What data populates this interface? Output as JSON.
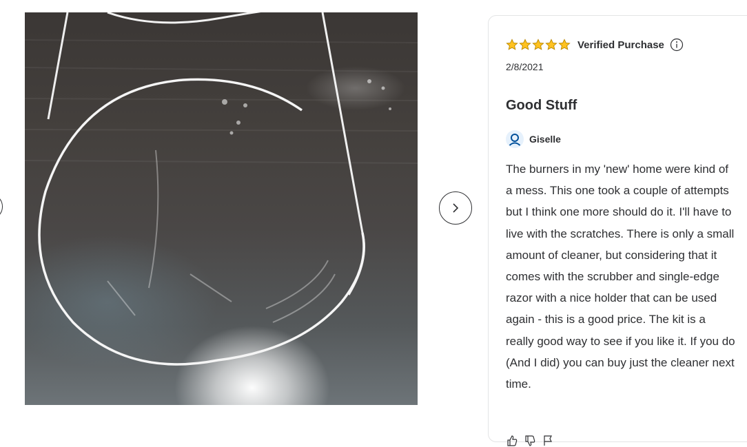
{
  "review": {
    "rating": 5,
    "rating_max": 5,
    "verified_label": "Verified Purchase",
    "date": "2/8/2021",
    "title": "Good Stuff",
    "author": "Giselle",
    "body": "The burners in my 'new' home were kind of a mess. This one took a couple of attempts but I think one more should do it. I'll have to live with the scratches. There is only a small amount of cleaner, but considering that it comes with the scrubber and single-edge razor with a nice holder that can be used again - this is a good price. The kit is a really good way to see if you like it. If you do (And I did) you can buy just the cleaner next time.",
    "helpful_count": "",
    "unhelpful_count": ""
  },
  "icons": {
    "prev": "chevron-left-icon",
    "next": "chevron-right-icon",
    "star": "star-icon",
    "info": "info-icon",
    "avatar": "user-icon",
    "thumbs_up": "thumbs-up-icon",
    "thumbs_down": "thumbs-down-icon",
    "flag": "flag-icon"
  },
  "colors": {
    "star": "#ffc220",
    "star_stroke": "#b88700",
    "avatar_bg": "#e6f1fc",
    "avatar_icon": "#004f9a",
    "text": "#2e2f32"
  }
}
